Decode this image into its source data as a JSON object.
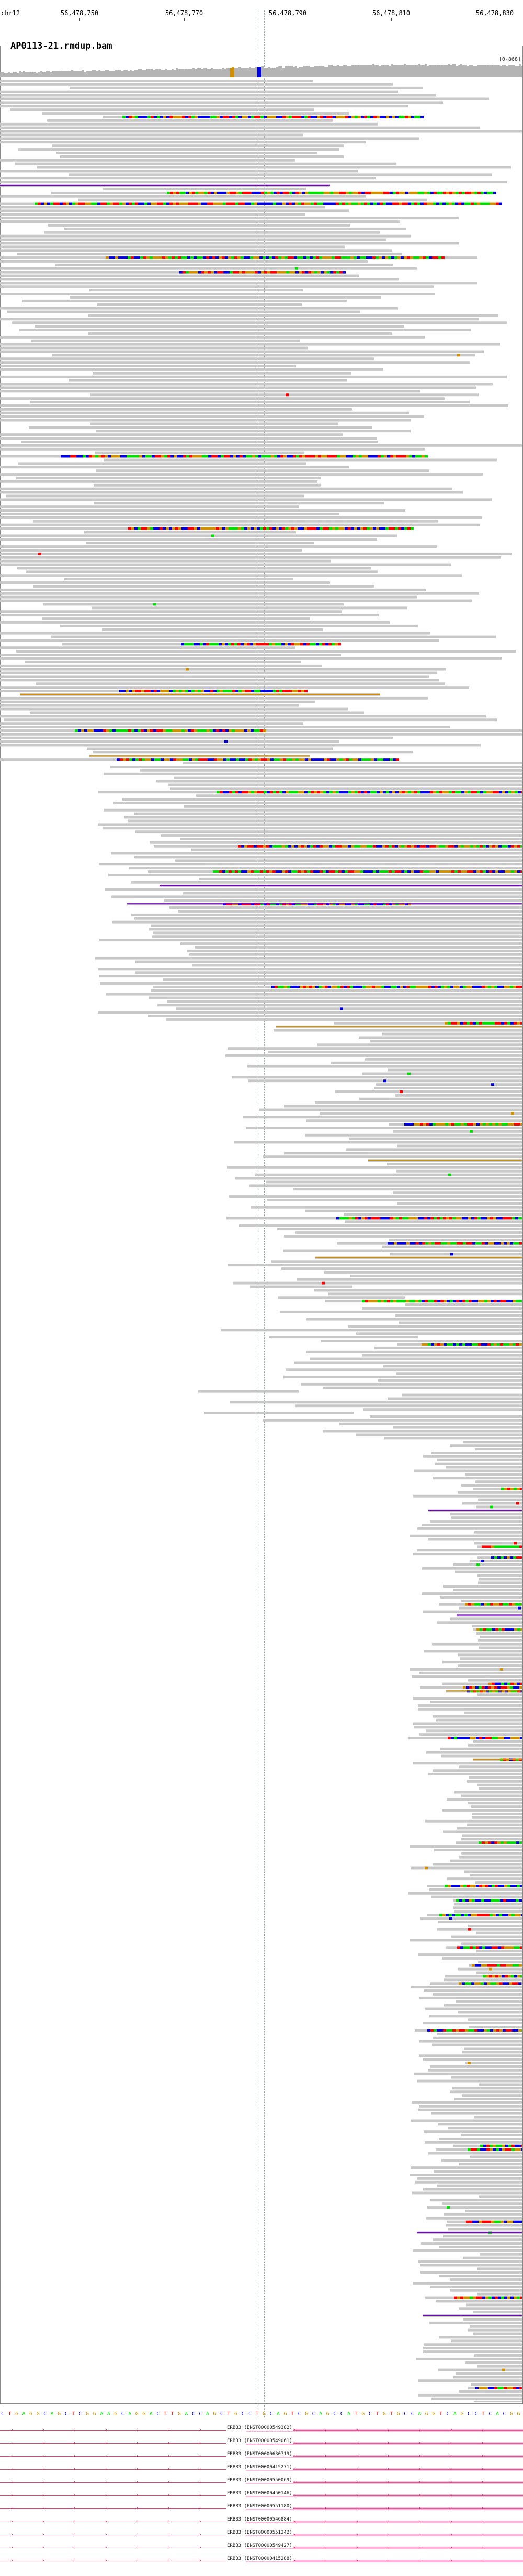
{
  "ruler": {
    "chrom": "chr12",
    "ticks": [
      "56,478,750",
      "56,478,770",
      "56,478,790",
      "56,478,810",
      "56,478,830"
    ]
  },
  "track": {
    "title": "AP0113-21.rmdup.bam",
    "scale": "[0-868]"
  },
  "reference_sequence": "CTGAGGCAGCTCGGAAGCAGGACTTGACCAGCTGCCTGCAGTCGCAGCCATGCTGTGCCAGGTCAGCCTCACGG",
  "genes": [
    {
      "name": "ERBB3 (ENST00000549382)"
    },
    {
      "name": "ERBB3 (ENST00000549061)"
    },
    {
      "name": "ERBB3 (ENST00000630719)"
    },
    {
      "name": "ERBB3 (ENST00000415271)"
    },
    {
      "name": "ERBB3 (ENST00000550069)"
    },
    {
      "name": "ERBB3 (ENST00000450146)"
    },
    {
      "name": "ERBB3 (ENST00000551180)"
    },
    {
      "name": "ERBB3 (ENST00000546884)"
    },
    {
      "name": "ERBB3 (ENST00000551242)"
    },
    {
      "name": "ERBB3 (ENST00000549427)"
    },
    {
      "name": "ERBB3 (ENST00000415288)"
    }
  ],
  "colors": {
    "read": "#c8c8c8",
    "mismatch_A": "#00e000",
    "mismatch_C": "#0000e0",
    "mismatch_G": "#d19000",
    "mismatch_T": "#ff0000",
    "insertion": "#7a00c8",
    "gene": "#d44466"
  }
}
